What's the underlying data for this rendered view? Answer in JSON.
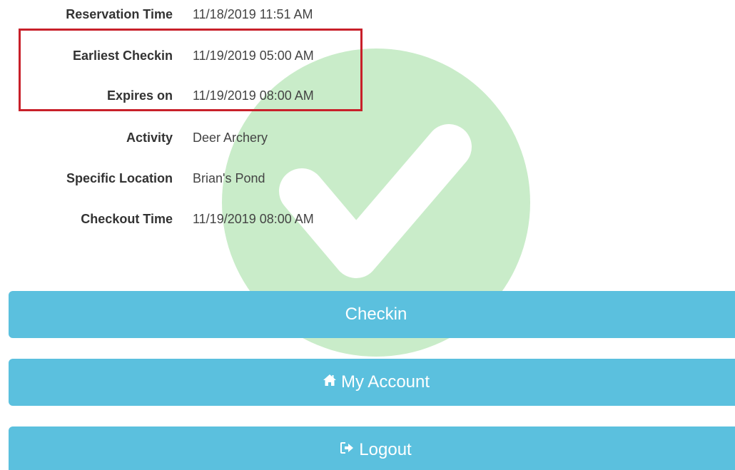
{
  "details": [
    {
      "label": "Reservation Time",
      "value": "11/18/2019 11:51 AM"
    },
    {
      "label": "Earliest Checkin",
      "value": "11/19/2019 05:00 AM"
    },
    {
      "label": "Expires on",
      "value": "11/19/2019 08:00 AM"
    },
    {
      "label": "Activity",
      "value": "Deer Archery"
    },
    {
      "label": "Specific Location",
      "value": "Brian's Pond"
    },
    {
      "label": "Checkout Time",
      "value": "11/19/2019 08:00 AM"
    }
  ],
  "buttons": {
    "checkin": {
      "label": "Checkin"
    },
    "my_account": {
      "label": "My Account",
      "icon": "home-icon"
    },
    "logout": {
      "label": "Logout",
      "icon": "sign-out-icon"
    }
  },
  "colors": {
    "button_bg": "#5bc0de",
    "highlight_border": "#c8202a",
    "watermark_circle": "#c9ecc9"
  }
}
